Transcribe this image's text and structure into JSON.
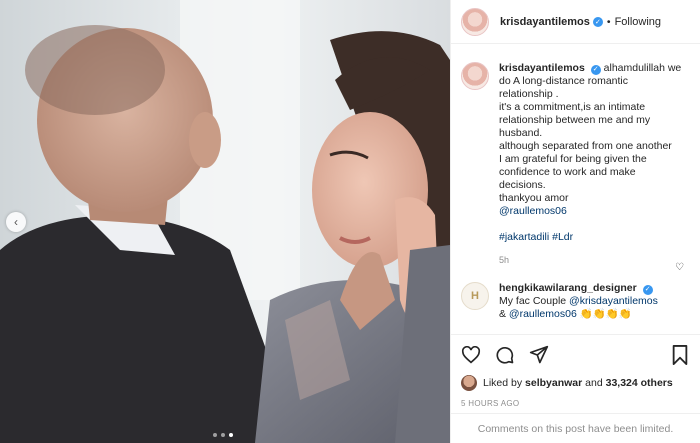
{
  "post": {
    "username": "krisdayantilemos",
    "follow_separator": "•",
    "follow_status": "Following",
    "caption_lines": [
      "alhamdulillah we",
      "do A long-distance romantic",
      "relationship .",
      "it's a commitment,is an intimate",
      "relationship between me and my",
      "husband.",
      "although separated from one another",
      "I am grateful for being given the",
      "confidence to work and make",
      "decisions.",
      "thankyou amor"
    ],
    "mention": "@raullemos06",
    "hashtags": "#jakartadili #Ldr",
    "time": "5h"
  },
  "comment": {
    "username": "hengkikawilarang_designer",
    "avatar_letter": "H",
    "text_prefix": "My fac Couple ",
    "mention1": "@krisdayantilemos",
    "text_line2_prefix": "& ",
    "mention2": "@raullemos06",
    "emojis": "👏👏👏👏"
  },
  "likes": {
    "prefix": "Liked by ",
    "user": "selbyanwar",
    "middle": " and ",
    "count": "33,324 others"
  },
  "posted_ago": "5 HOURS AGO",
  "comments_limited": "Comments on this post have been limited.",
  "carousel": {
    "current": 3,
    "total": 3
  },
  "colors": {
    "verified": "#3897f0",
    "link": "#00376b",
    "muted": "#8e8e8e"
  },
  "icons": [
    "heart-icon",
    "comment-icon",
    "share-icon",
    "bookmark-icon",
    "chevron-left-icon"
  ]
}
